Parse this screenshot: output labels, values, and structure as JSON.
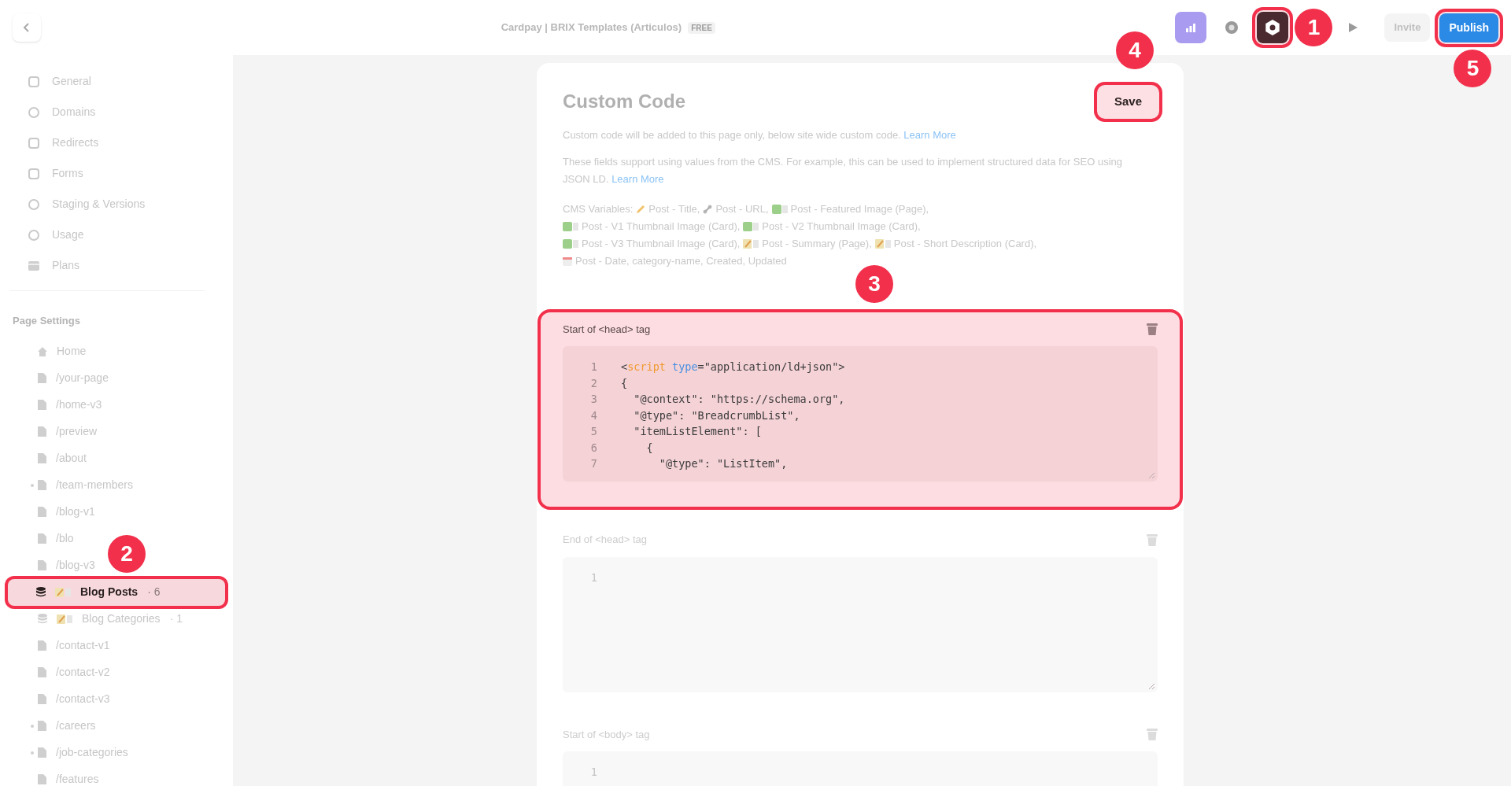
{
  "topbar": {
    "title": "Cardpay | BRIX Templates (Articulos)",
    "badge": "FREE",
    "tools": [
      {
        "kind": "chart",
        "highlighted": false
      },
      {
        "kind": "circle",
        "highlighted": false
      },
      {
        "kind": "settings",
        "highlighted": true,
        "callout": "1"
      },
      {
        "kind": "play",
        "highlighted": false
      }
    ],
    "invite": "Invite",
    "publish": {
      "label": "Publish",
      "highlighted": true,
      "callout": "5"
    }
  },
  "sidebar": {
    "menu": [
      {
        "label": "General",
        "kind": "square"
      },
      {
        "label": "Domains",
        "kind": "globe"
      },
      {
        "label": "Redirects",
        "kind": "square"
      },
      {
        "label": "Forms",
        "kind": "square"
      },
      {
        "label": "Staging & Versions",
        "kind": "globe"
      },
      {
        "label": "Usage",
        "kind": "globe"
      },
      {
        "label": "Plans",
        "kind": "card"
      }
    ],
    "heading": "Page Settings",
    "pages": [
      {
        "label": "Home",
        "kind": "home",
        "expandable": false,
        "selected": false
      },
      {
        "label": "/your-page",
        "kind": "page",
        "expandable": false,
        "selected": false
      },
      {
        "label": "/home-v3",
        "kind": "page",
        "expandable": false,
        "selected": false
      },
      {
        "label": "/preview",
        "kind": "page",
        "expandable": false,
        "selected": false
      },
      {
        "label": "/about",
        "kind": "page",
        "expandable": false,
        "selected": false
      },
      {
        "label": "/team-members",
        "kind": "page",
        "expandable": true,
        "selected": false
      },
      {
        "label": "/blog-v1",
        "kind": "page",
        "expandable": false,
        "selected": false
      },
      {
        "label": "/blo",
        "kind": "page",
        "expandable": false,
        "selected": false
      },
      {
        "label": "/blog-v3",
        "kind": "page",
        "expandable": false,
        "selected": false
      },
      {
        "label": "Blog Posts",
        "kind": "cms",
        "count": "· 6",
        "expandable": false,
        "selected": true,
        "highlighted": true,
        "callout": "2"
      },
      {
        "label": "Blog Categories",
        "kind": "cms",
        "count": "· 1",
        "expandable": false,
        "selected": false
      },
      {
        "label": "/contact-v1",
        "kind": "page",
        "expandable": false,
        "selected": false
      },
      {
        "label": "/contact-v2",
        "kind": "page",
        "expandable": false,
        "selected": false
      },
      {
        "label": "/contact-v3",
        "kind": "page",
        "expandable": false,
        "selected": false
      },
      {
        "label": "/careers",
        "kind": "page",
        "expandable": true,
        "selected": false
      },
      {
        "label": "/job-categories",
        "kind": "page",
        "expandable": true,
        "selected": false
      },
      {
        "label": "/features",
        "kind": "page",
        "expandable": false,
        "selected": false
      }
    ]
  },
  "panel": {
    "title": "Custom Code",
    "save": {
      "label": "Save",
      "highlighted": true,
      "callout": "4"
    },
    "notes": [
      {
        "text": "Custom code will be added to this page only, below site wide custom code.",
        "link": "Learn More"
      },
      {
        "text": "These fields support using values from the CMS. For example, this can be used to implement structured data for SEO using JSON LD.",
        "link": "Learn More"
      }
    ],
    "cms_label": "CMS Variables:",
    "cms_lines": [
      [
        {
          "text": "Post - Title,",
          "kind": "pencil"
        },
        {
          "text": "Post - URL,",
          "kind": "link"
        },
        {
          "text": "Post - Featured Image (Page),",
          "kind": "image"
        }
      ],
      [
        {
          "text": "Post - V1 Thumbnail Image (Card),",
          "kind": "image"
        },
        {
          "text": "Post - V2 Thumbnail Image (Card),",
          "kind": "image"
        }
      ],
      [
        {
          "text": "Post - V3 Thumbnail Image (Card),",
          "kind": "image"
        },
        {
          "text": "Post - Summary (Page),",
          "kind": "memo"
        },
        {
          "text": "Post - Short Description (Card),",
          "kind": "memo"
        }
      ],
      [
        {
          "text": "Post - Date, category-name, Created, Updated",
          "kind": "calendar"
        }
      ]
    ],
    "sections": [
      {
        "label": "Start of <head> tag",
        "highlighted": true,
        "callout": "3",
        "lines": [
          {
            "number": "1",
            "segments": [
              {
                "text": "<",
                "kind": "plain"
              },
              {
                "text": "script",
                "kind": "tag"
              },
              {
                "text": " type",
                "kind": "attr"
              },
              {
                "text": "=\"application/ld+json\">",
                "kind": "plain"
              }
            ]
          },
          {
            "number": "2",
            "segments": [
              {
                "text": "{",
                "kind": "plain"
              }
            ]
          },
          {
            "number": "3",
            "segments": [
              {
                "text": "  \"@context\": \"https://schema.org\",",
                "kind": "plain"
              }
            ]
          },
          {
            "number": "4",
            "segments": [
              {
                "text": "  \"@type\": \"BreadcrumbList\",",
                "kind": "plain"
              }
            ]
          },
          {
            "number": "5",
            "segments": [
              {
                "text": "  \"itemListElement\": [",
                "kind": "plain"
              }
            ]
          },
          {
            "number": "6",
            "segments": [
              {
                "text": "    {",
                "kind": "plain"
              }
            ]
          },
          {
            "number": "7",
            "segments": [
              {
                "text": "      \"@type\": \"ListItem\",",
                "kind": "plain"
              }
            ]
          }
        ]
      },
      {
        "label": "End of <head> tag",
        "highlighted": false,
        "lines": [
          {
            "number": "1"
          }
        ]
      },
      {
        "label": "Start of <body> tag",
        "highlighted": false,
        "lines": [
          {
            "number": "1"
          }
        ]
      }
    ]
  }
}
